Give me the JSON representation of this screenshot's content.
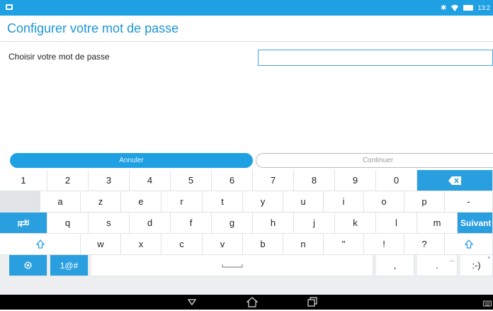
{
  "status_bar": {
    "time": "13:2",
    "icons": [
      "notification-icon",
      "bluetooth-icon",
      "wifi-icon",
      "battery-icon"
    ],
    "color": "#1fa0e3"
  },
  "page": {
    "title": "Configurer votre mot de passe",
    "password_label": "Choisir votre mot de passe",
    "password_value": ""
  },
  "actions": {
    "cancel_label": "Annuler",
    "continue_label": "Continuer"
  },
  "keyboard": {
    "row1": [
      "1",
      "2",
      "3",
      "4",
      "5",
      "6",
      "7",
      "8",
      "9",
      "0"
    ],
    "row2": [
      "a",
      "z",
      "e",
      "r",
      "t",
      "y",
      "u",
      "i",
      "o",
      "p",
      "-"
    ],
    "row3": [
      "q",
      "s",
      "d",
      "f",
      "g",
      "h",
      "j",
      "k",
      "l",
      "m"
    ],
    "row3_action": "Suivant",
    "row4": [
      "w",
      "x",
      "c",
      "v",
      "b",
      "n",
      "\"",
      "!",
      "?"
    ],
    "row5_symbols": "1@#",
    "row5_comma": ",",
    "row5_period": ".",
    "row5_period_hint": "...",
    "row5_smiley": ":-)",
    "row5_smiley_hint": "\"",
    "accent_color": "#2a9fe0"
  },
  "nav_bar": {
    "icons": [
      "back-icon",
      "home-icon",
      "recents-icon",
      "keyboard-switch-icon"
    ]
  }
}
